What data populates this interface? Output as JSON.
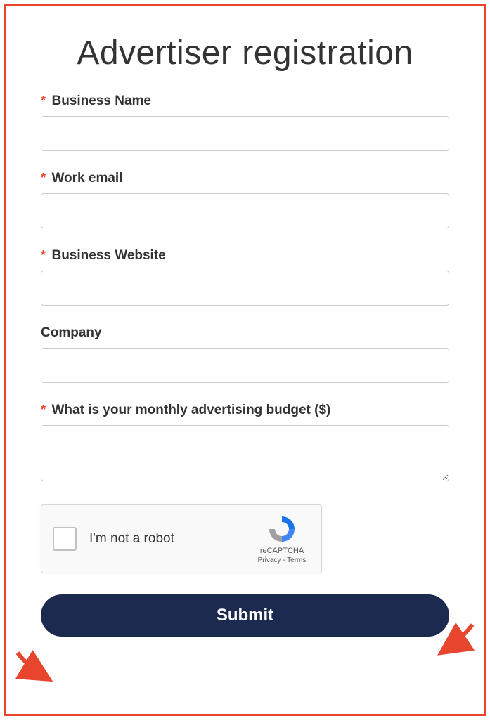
{
  "title": "Advertiser registration",
  "required_marker": "*",
  "fields": {
    "business_name": {
      "label": "Business Name",
      "required": true,
      "value": ""
    },
    "work_email": {
      "label": "Work email",
      "required": true,
      "value": ""
    },
    "business_website": {
      "label": "Business Website",
      "required": true,
      "value": ""
    },
    "company": {
      "label": "Company",
      "required": false,
      "value": ""
    },
    "budget": {
      "label": "What is your monthly advertising budget ($)",
      "required": true,
      "value": ""
    }
  },
  "recaptcha": {
    "label": "I'm not a robot",
    "brand": "reCAPTCHA",
    "links": "Privacy - Terms"
  },
  "submit_label": "Submit"
}
